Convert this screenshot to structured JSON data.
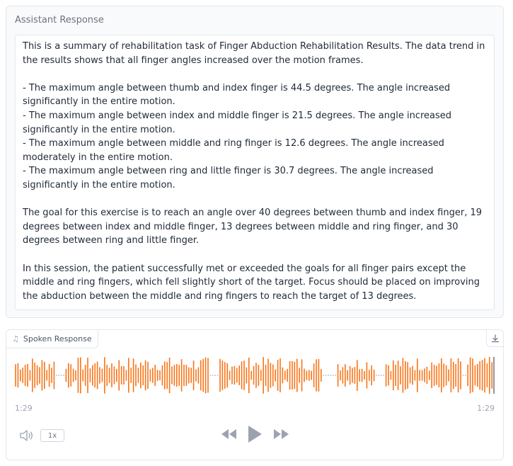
{
  "response_panel": {
    "label": "Assistant Response",
    "paragraphs": [
      "This is a summary of rehabilitation task of Finger Abduction Rehabilitation Results. The data trend in the results shows that all finger angles increased over the motion frames.",
      "",
      "- The maximum angle between thumb and index finger is 44.5 degrees. The angle increased significantly in the entire motion.",
      "- The maximum angle between index and middle finger is 21.5 degrees. The angle increased significantly in the entire motion.",
      "- The maximum angle between middle and ring finger is 12.6 degrees. The angle increased moderately in the entire motion.",
      "- The maximum angle between ring and little finger is 30.7 degrees. The angle increased significantly in the entire motion.",
      "",
      "The goal for this exercise is to reach an angle over 40 degrees between thumb and index finger, 19 degrees between index and middle finger, 13 degrees between middle and ring finger, and 30 degrees between ring and little finger.",
      "",
      "In this session, the patient successfully met or exceeded the goals for all finger pairs except the middle and ring fingers, which fell slightly short of the target. Focus should be placed on improving the abduction between the middle and ring fingers to reach the target of 13 degrees."
    ]
  },
  "audio_player": {
    "label": "Spoken Response",
    "label_icon": "music-note-icon",
    "download_icon": "download-icon",
    "current_time": "1:29",
    "duration": "1:29",
    "playback_rate": "1x",
    "icons": {
      "volume": "volume-icon",
      "rewind": "rewind-icon",
      "play": "play-icon",
      "forward": "fast-forward-icon"
    },
    "colors": {
      "waveform": "#f97316",
      "waveform_silence": "#9ca3af",
      "controls": "#9ca3af"
    },
    "progress": 1.0
  }
}
